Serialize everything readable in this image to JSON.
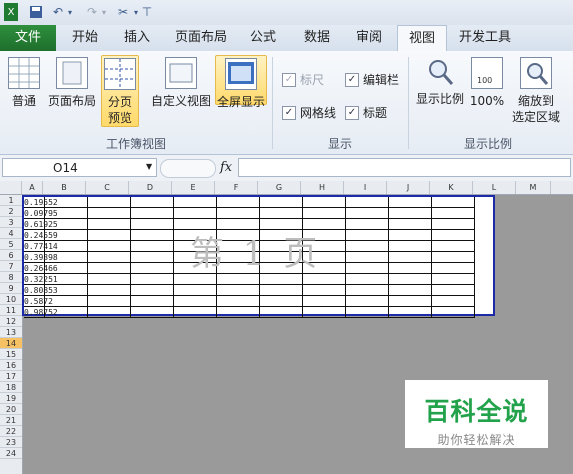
{
  "qat": {
    "undo_icon": "undo-icon",
    "redo_icon": "redo-icon",
    "save_icon": "save-icon"
  },
  "tabs": [
    {
      "label": "文件"
    },
    {
      "label": "开始"
    },
    {
      "label": "插入"
    },
    {
      "label": "页面布局"
    },
    {
      "label": "公式"
    },
    {
      "label": "数据"
    },
    {
      "label": "审阅"
    },
    {
      "label": "视图"
    },
    {
      "label": "开发工具"
    }
  ],
  "ribbon": {
    "views": [
      {
        "label": "普通"
      },
      {
        "label": "页面布局"
      },
      {
        "label": "分页\n预览"
      },
      {
        "label": "自定义视图"
      },
      {
        "label": "全屏显示"
      }
    ],
    "views_group": "工作簿视图",
    "show": [
      {
        "label": "标尺",
        "checked": true,
        "disabled": true
      },
      {
        "label": "编辑栏",
        "checked": true,
        "disabled": false
      },
      {
        "label": "网格线",
        "checked": true,
        "disabled": false
      },
      {
        "label": "标题",
        "checked": true,
        "disabled": false
      }
    ],
    "show_group": "显示",
    "zoom": [
      {
        "label": "显示比例"
      },
      {
        "label": "100%"
      },
      {
        "label": "缩放到\n选定区域"
      }
    ],
    "zoom_group": "显示比例"
  },
  "formula_bar": {
    "name_box": "O14",
    "fx": "fx",
    "value": ""
  },
  "sheet": {
    "columns": [
      "A",
      "B",
      "C",
      "D",
      "E",
      "F",
      "G",
      "H",
      "I",
      "J",
      "K",
      "L",
      "M"
    ],
    "rows": [
      "1",
      "2",
      "3",
      "4",
      "5",
      "6",
      "7",
      "8",
      "9",
      "10",
      "11",
      "12",
      "13",
      "14",
      "15",
      "16",
      "17",
      "18",
      "19",
      "20",
      "21",
      "22",
      "23",
      "24"
    ],
    "selected_row": "14",
    "col_a_values": [
      "0.19552",
      "0.09795",
      "0.61925",
      "0.24559",
      "0.77414",
      "0.39398",
      "0.26466",
      "0.32251",
      "0.80853",
      "0.5872",
      "0.98752"
    ],
    "watermark": "第 1 页"
  },
  "logo": {
    "title": "百科全说",
    "subtitle": "助你轻松解决"
  },
  "colors": {
    "file_tab": "#2a8a3a",
    "print_border": "#1d2aa8",
    "highlight": "#ffd96a",
    "logo_green": "#22a24a"
  }
}
